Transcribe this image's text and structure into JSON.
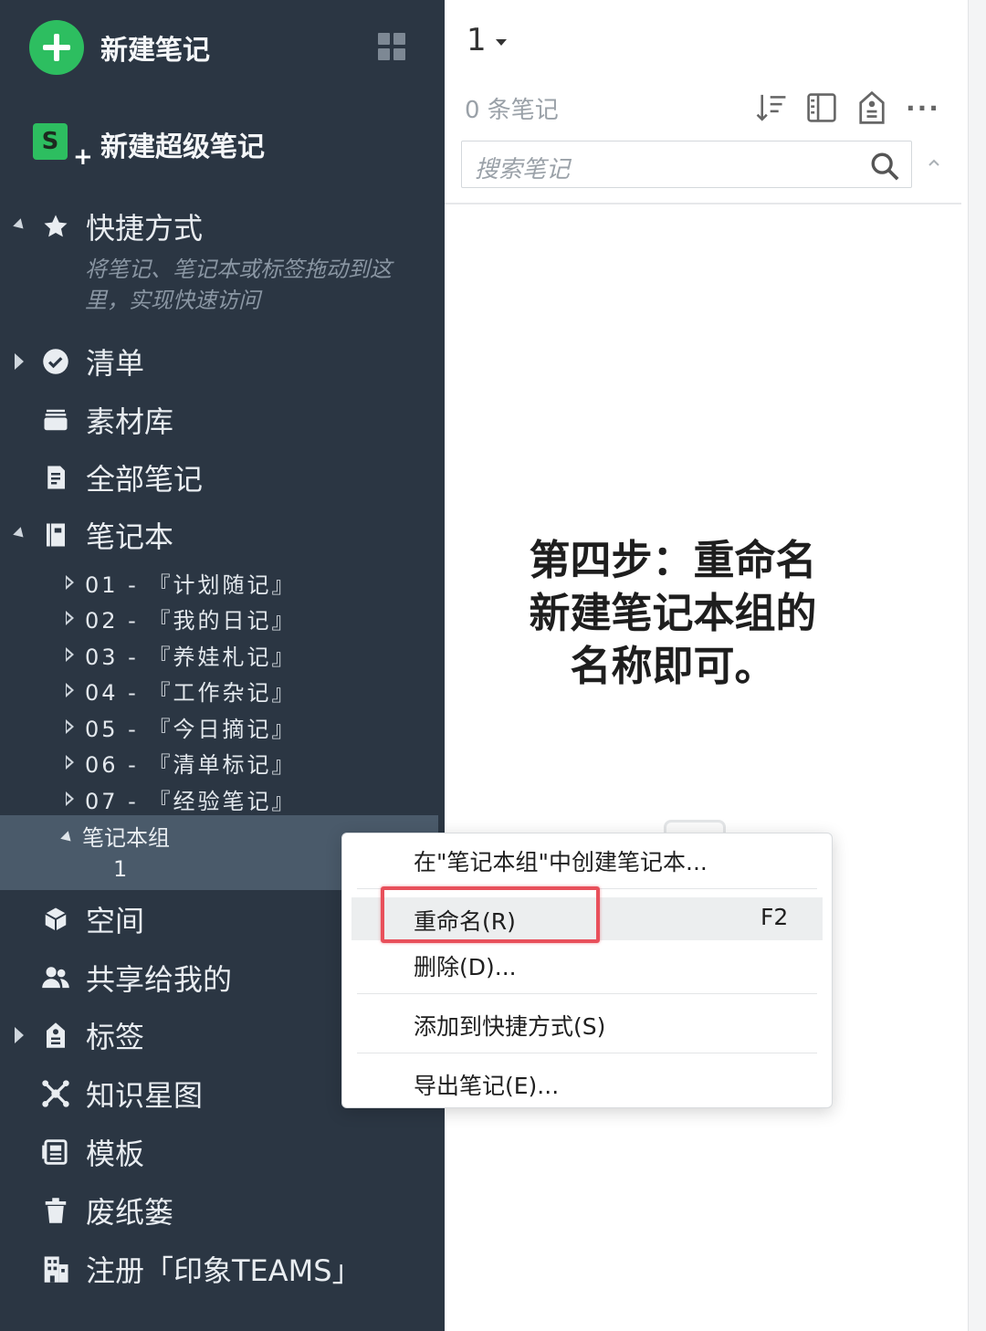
{
  "sidebar": {
    "new_note": "新建笔记",
    "new_super_note": "新建超级笔记",
    "super_note_icon_letter": "S",
    "super_note_icon_plus": "+",
    "shortcuts": {
      "label": "快捷方式",
      "hint": "将笔记、笔记本或标签拖动到这里，实现快速访问"
    },
    "items": {
      "checklist": "清单",
      "library": "素材库",
      "all_notes": "全部笔记",
      "notebooks": "笔记本",
      "spaces": "空间",
      "shared_with_me": "共享给我的",
      "tags": "标签",
      "knowledge_graph": "知识星图",
      "templates": "模板",
      "trash": "废纸篓",
      "register_teams": "注册「印象TEAMS」"
    },
    "notebooks": [
      "01 - 『计划随记』",
      "02 - 『我的日记』",
      "03 - 『养娃札记』",
      "04 - 『工作杂记』",
      "05 - 『今日摘记』",
      "06 - 『清单标记』",
      "07 - 『经验笔记』"
    ],
    "notebook_group": {
      "label": "笔记本组",
      "child": "1"
    }
  },
  "panel": {
    "notebook_title": "1",
    "note_count": "0 条笔记",
    "search_placeholder": "搜索笔记",
    "more_glyph": "···"
  },
  "annotation": {
    "step_text": "第四步：重命名新建笔记本组的名称即可。"
  },
  "context_menu": {
    "create_in_group": "在\"笔记本组\"中创建笔记本...",
    "rename": "重命名(R)",
    "rename_shortcut": "F2",
    "delete": "删除(D)...",
    "add_shortcut": "添加到快捷方式(S)",
    "export": "导出笔记(E)..."
  },
  "colors": {
    "sidebar_bg": "#2b3643",
    "accent_green": "#2dbe60",
    "selected_row": "#4a5a6a",
    "highlight_red": "#e8505b"
  },
  "icons": {
    "new_note": "plus-circle-icon",
    "layout": "grid-icon",
    "super_note": "super-note-icon",
    "shortcuts": "star-icon",
    "checklist": "check-circle-icon",
    "library": "stack-icon",
    "all_notes": "note-icon",
    "notebooks": "notebook-icon",
    "spaces": "cube-icon",
    "shared": "users-icon",
    "tags": "tag-icon",
    "knowledge_graph": "graph-icon",
    "templates": "template-icon",
    "trash": "trash-icon",
    "teams": "building-icon",
    "sort": "sort-icon",
    "view": "view-toggle-icon",
    "tag_filter": "tag-filter-icon",
    "more": "more-icon",
    "search": "search-icon",
    "collapse": "chevron-up-icon"
  }
}
